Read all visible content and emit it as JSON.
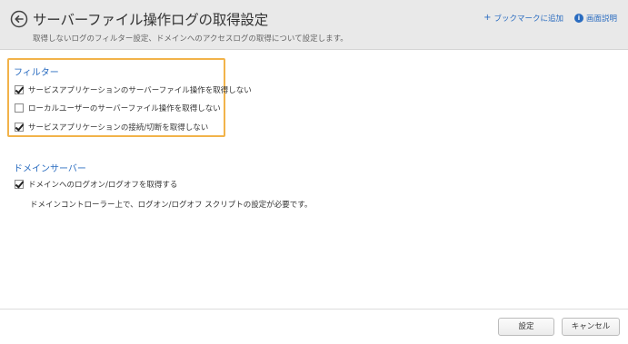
{
  "header": {
    "title": "サーバーファイル操作ログの取得設定",
    "subtitle": "取得しないログのフィルター設定、ドメインへのアクセスログの取得について設定します。",
    "bookmark_label": "ブックマークに追加",
    "help_label": "画面説明",
    "info_glyph": "i"
  },
  "filter": {
    "title": "フィルター",
    "items": [
      {
        "label": "サービスアプリケーションのサーバーファイル操作を取得しない",
        "checked": true
      },
      {
        "label": "ローカルユーザーのサーバーファイル操作を取得しない",
        "checked": false
      },
      {
        "label": "サービスアプリケーションの接続/切断を取得しない",
        "checked": true
      }
    ]
  },
  "domain_server": {
    "title": "ドメインサーバー",
    "logon_label": "ドメインへのログオン/ログオフを取得する",
    "logon_checked": true,
    "note": "ドメインコントローラー上で、ログオン/ログオフ スクリプトの設定が必要です。"
  },
  "footer": {
    "ok_label": "設定",
    "cancel_label": "キャンセル"
  },
  "colors": {
    "accent": "#2a6cc0",
    "highlight_border": "#f2b34a",
    "header_bg": "#e9e9e9"
  },
  "icons": {
    "back": "back-arrow-circle-icon",
    "bookmark": "plus-icon",
    "help": "info-icon",
    "checkbox": "checkmark-icon"
  }
}
